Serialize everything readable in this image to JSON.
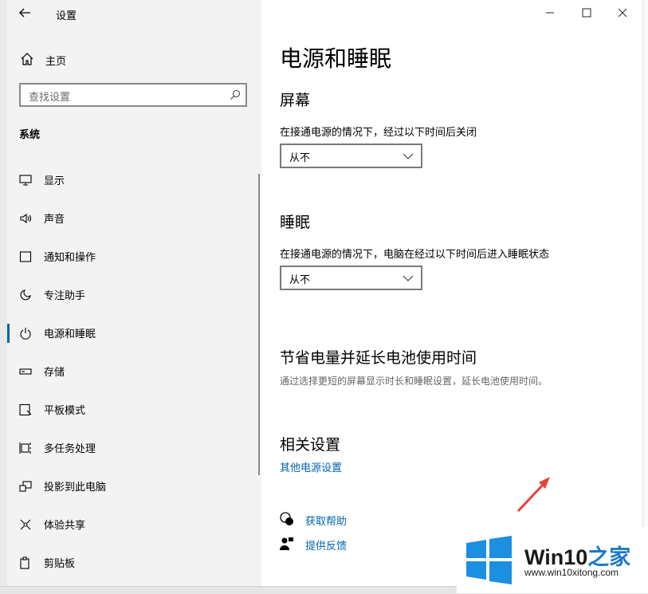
{
  "window": {
    "app_title": "设置",
    "back_icon": "back-arrow-icon",
    "controls": [
      "minimize-icon",
      "maximize-icon",
      "close-icon"
    ]
  },
  "sidebar": {
    "home_label": "主页",
    "search_placeholder": "查找设置",
    "section_title": "系统",
    "items": [
      {
        "label": "显示",
        "icon": "monitor-icon"
      },
      {
        "label": "声音",
        "icon": "speaker-icon"
      },
      {
        "label": "通知和操作",
        "icon": "notification-icon"
      },
      {
        "label": "专注助手",
        "icon": "moon-icon"
      },
      {
        "label": "电源和睡眠",
        "icon": "power-icon",
        "active": true
      },
      {
        "label": "存储",
        "icon": "storage-icon"
      },
      {
        "label": "平板模式",
        "icon": "tablet-icon"
      },
      {
        "label": "多任务处理",
        "icon": "multitask-icon"
      },
      {
        "label": "投影到此电脑",
        "icon": "project-icon"
      },
      {
        "label": "体验共享",
        "icon": "share-icon"
      },
      {
        "label": "剪贴板",
        "icon": "clipboard-icon"
      }
    ],
    "accent": "#0063b1"
  },
  "main": {
    "page_title": "电源和睡眠",
    "screen": {
      "heading": "屏幕",
      "description": "在接通电源的情况下，经过以下时间后关闭",
      "value": "从不"
    },
    "sleep": {
      "heading": "睡眠",
      "description": "在接通电源的情况下，电脑在经过以下时间后进入睡眠状态",
      "value": "从不"
    },
    "battery": {
      "heading": "节省电量并延长电池使用时间",
      "description": "通过选择更短的屏幕显示时长和睡眠设置，延长电池使用时间。"
    },
    "related": {
      "heading": "相关设置",
      "link": "其他电源设置"
    },
    "help": {
      "get_help": "获取帮助",
      "feedback": "提供反馈"
    },
    "link_color": "#0063b1"
  },
  "watermark": {
    "brand_prefix": "Win10",
    "brand_suffix": "之家",
    "url": "www.win10xitong.com"
  }
}
